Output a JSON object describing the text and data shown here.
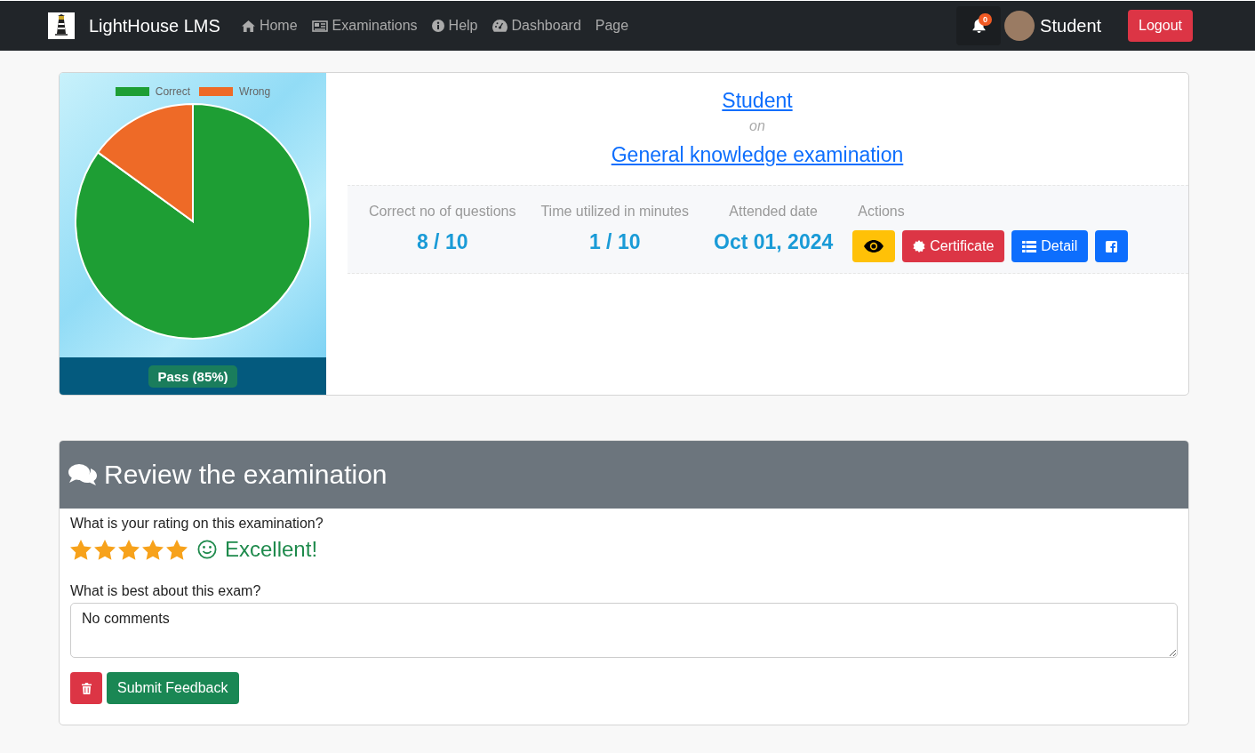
{
  "navbar": {
    "brand": "LightHouse LMS",
    "links": [
      {
        "label": "Home"
      },
      {
        "label": "Examinations"
      },
      {
        "label": "Help"
      },
      {
        "label": "Dashboard"
      },
      {
        "label": "Page"
      }
    ],
    "notification_count": "0",
    "user": "Student",
    "logout": "Logout"
  },
  "result": {
    "chart_data": {
      "type": "pie",
      "categories": [
        "Correct",
        "Wrong"
      ],
      "values": [
        85,
        15
      ],
      "colors": [
        "#1e9e34",
        "#ee6a27"
      ],
      "legend": "top"
    },
    "status": "Pass (85%)",
    "student": "Student",
    "on": "on",
    "exam": "General knowledge examination",
    "stats": [
      {
        "label": "Correct no of questions",
        "value": "8 / 10"
      },
      {
        "label": "Time utilized in minutes",
        "value": "1 / 10"
      },
      {
        "label": "Attended date",
        "value": "Oct 01, 2024"
      }
    ],
    "actions_label": "Actions",
    "actions": [
      {
        "kind": "view"
      },
      {
        "kind": "certificate",
        "label": "Certificate"
      },
      {
        "kind": "detail",
        "label": "Detail"
      },
      {
        "kind": "facebook"
      }
    ]
  },
  "review": {
    "title": "Review the examination",
    "rating_question": "What is your rating on this examination?",
    "stars": 5,
    "rating_text": "Excellent!",
    "comment_label": "What is best about this exam?",
    "comment": "No comments",
    "submit": "Submit Feedback"
  }
}
